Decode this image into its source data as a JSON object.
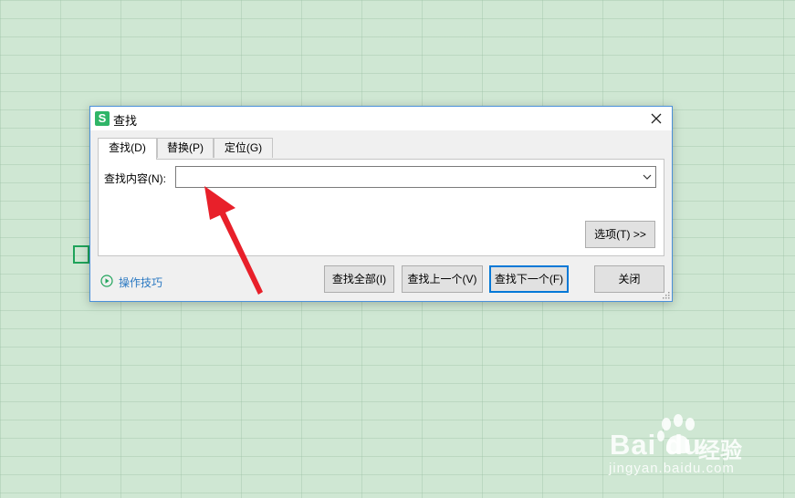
{
  "dialog": {
    "title": "查找",
    "app_icon_glyph": "S",
    "close_glyph": "✕",
    "tabs": [
      {
        "label": "查找(D)",
        "active": true
      },
      {
        "label": "替换(P)",
        "active": false
      },
      {
        "label": "定位(G)",
        "active": false
      }
    ],
    "find": {
      "label": "查找内容(N):",
      "value": "",
      "placeholder": ""
    },
    "options_button": "选项(T) >>",
    "tips_link": "操作技巧",
    "buttons": {
      "find_all": "查找全部(I)",
      "find_prev": "查找上一个(V)",
      "find_next": "查找下一个(F)",
      "close": "关闭"
    }
  },
  "watermark": {
    "logo": "Bai  du",
    "text": "经验",
    "url": "jingyan.baidu.com"
  },
  "colors": {
    "background": "#cfe7d3",
    "accent": "#0078d7",
    "arrow": "#e8202a",
    "app_icon": "#2fb568",
    "link": "#2b79c2"
  },
  "icons": {
    "app": "wps-s-icon",
    "close": "close-icon",
    "dropdown": "chevron-down-icon",
    "tips": "play-circle-icon",
    "grip": "resize-grip-icon",
    "annotation": "red-arrow-icon"
  }
}
